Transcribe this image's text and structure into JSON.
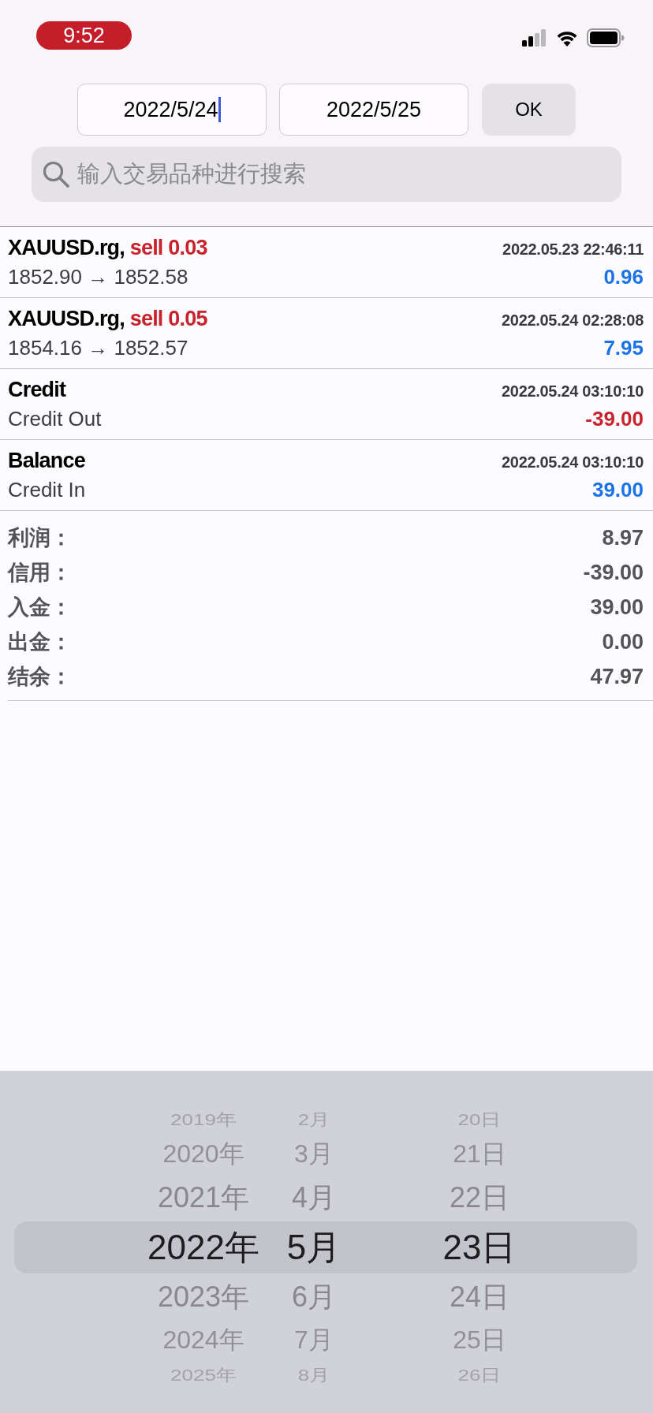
{
  "status_bar": {
    "time": "9:52"
  },
  "date_range": {
    "fields": [
      {
        "value": "2022/5/24",
        "focused": true
      },
      {
        "value": "2022/5/25",
        "focused": false
      }
    ],
    "ok_button": "OK"
  },
  "search": {
    "placeholder": "输入交易品种进行搜索"
  },
  "deals": [
    {
      "kind": "trade",
      "symbol": "XAUUSD.rg,",
      "action": "sell 0.03",
      "time": "2022.05.23 22:46:11",
      "detail": "1852.90 → 1852.58",
      "amount": "0.96",
      "negative": false
    },
    {
      "kind": "trade",
      "symbol": "XAUUSD.rg,",
      "action": "sell 0.05",
      "time": "2022.05.24 02:28:08",
      "detail": "1854.16 → 1852.57",
      "amount": "7.95",
      "negative": false
    },
    {
      "kind": "operation",
      "symbol": "Credit",
      "time": "2022.05.24 03:10:10",
      "detail": "Credit Out",
      "amount": "-39.00",
      "negative": true
    },
    {
      "kind": "operation",
      "symbol": "Balance",
      "time": "2022.05.24 03:10:10",
      "detail": "Credit In",
      "amount": "39.00",
      "negative": false
    }
  ],
  "summary": [
    {
      "label": "利润：",
      "value": "8.97"
    },
    {
      "label": "信用：",
      "value": "-39.00"
    },
    {
      "label": "入金：",
      "value": "39.00"
    },
    {
      "label": "出金：",
      "value": "0.00"
    },
    {
      "label": "结余：",
      "value": "47.97"
    }
  ],
  "picker": {
    "rows": [
      {
        "year": "2019年",
        "month": "2月",
        "day": "20日",
        "selected": false
      },
      {
        "year": "2020年",
        "month": "3月",
        "day": "21日",
        "selected": false
      },
      {
        "year": "2021年",
        "month": "4月",
        "day": "22日",
        "selected": false
      },
      {
        "year": "2022年",
        "month": "5月",
        "day": "23日",
        "selected": true
      },
      {
        "year": "2023年",
        "month": "6月",
        "day": "24日",
        "selected": false
      },
      {
        "year": "2024年",
        "month": "7月",
        "day": "25日",
        "selected": false
      },
      {
        "year": "2025年",
        "month": "8月",
        "day": "26日",
        "selected": false
      }
    ]
  }
}
